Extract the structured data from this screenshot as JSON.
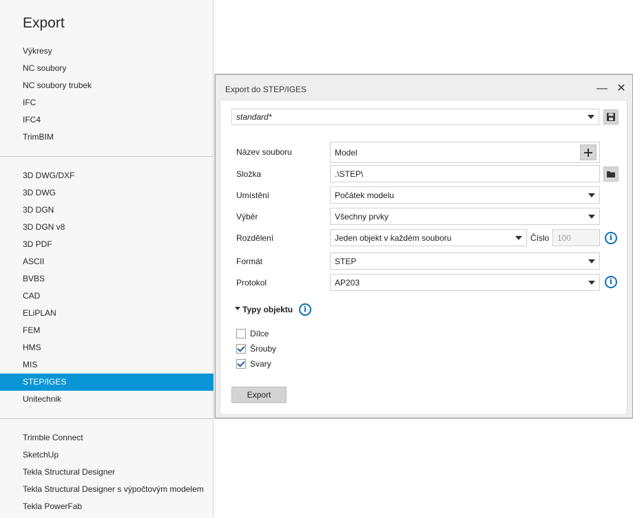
{
  "export_menu": {
    "title": "Export",
    "group1": [
      "Výkresy",
      "NC soubory",
      "NC soubory trubek",
      "IFC",
      "IFC4",
      "TrimBIM"
    ],
    "group2": [
      "3D DWG/DXF",
      "3D DWG",
      "3D DGN",
      "3D DGN v8",
      "3D PDF",
      "ASCII",
      "BVBS",
      "CAD",
      "ELiPLAN",
      "FEM",
      "HMS",
      "MIS",
      "STEP/IGES",
      "Unitechnik"
    ],
    "group3": [
      "Trimble Connect",
      "SketchUp",
      "Tekla Structural Designer",
      "Tekla Structural Designer s výpočtovým modelem",
      "Tekla PowerFab"
    ],
    "selected": "STEP/IGES"
  },
  "dialog": {
    "title": "Export do STEP/IGES",
    "minimize_glyph": "—",
    "close_glyph": "✕",
    "preset": "standard*",
    "fields": {
      "file_name_label": "Název souboru",
      "file_name_value": "Model",
      "folder_label": "Složka",
      "folder_value": ".\\STEP\\",
      "placement_label": "Umístění",
      "placement_value": "Počátek modelu",
      "selection_label": "Výběr",
      "selection_value": "Všechny prvky",
      "split_label": "Rozdělení",
      "split_value": "Jeden objekt v každém souboru",
      "number_label": "Číslo",
      "number_value": "100",
      "format_label": "Formát",
      "format_value": "STEP",
      "protocol_label": "Protokol",
      "protocol_value": "AP203"
    },
    "object_types": {
      "header": "Typy objektu",
      "items": [
        {
          "label": "Dílce",
          "checked": false
        },
        {
          "label": "Šrouby",
          "checked": true
        },
        {
          "label": "Svary",
          "checked": true
        }
      ]
    },
    "export_button": "Export"
  },
  "icons": {
    "save": "save-icon",
    "add": "plus-icon",
    "folder": "folder-icon",
    "info": "info-icon",
    "collapse": "caret-down-icon"
  },
  "colors": {
    "selection": "#0a96d6",
    "info": "#0a6fb3",
    "dialog_bg": "#eeeeee"
  }
}
